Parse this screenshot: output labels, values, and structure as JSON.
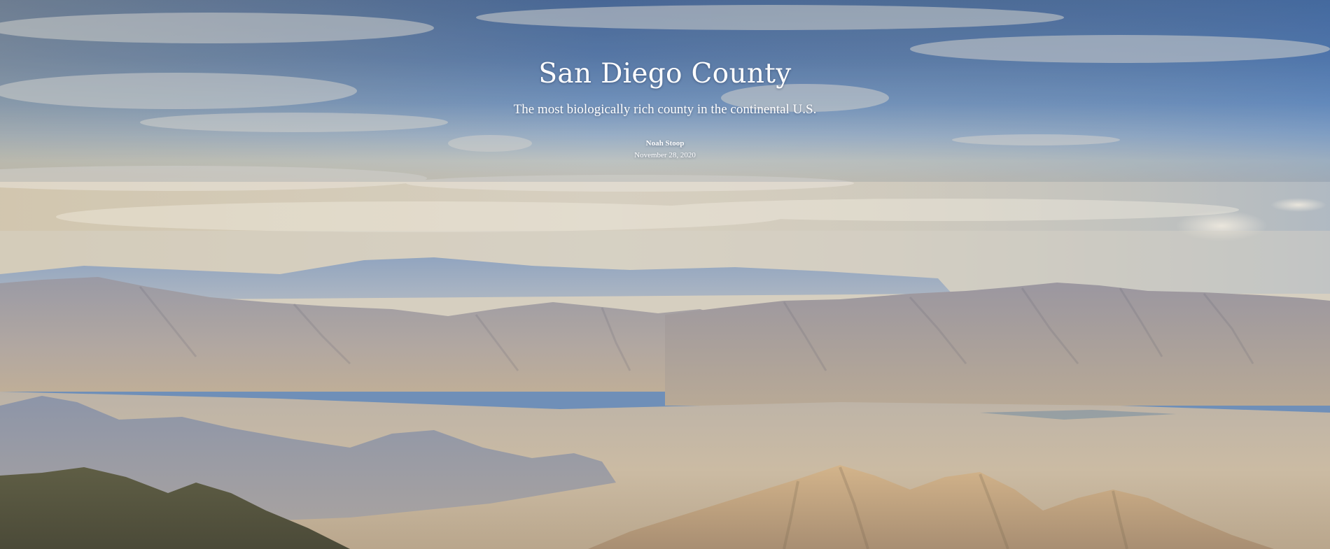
{
  "hero": {
    "title": "San Diego County",
    "subtitle": "The most biologically rich county in the continental U.S.",
    "author": "Noah Stoop",
    "date": "November 28, 2020"
  },
  "colors": {
    "sky_top": "#4f6f9e",
    "sky_mid": "#7d9cc4",
    "horizon_haze": "#d9d3c4",
    "far_mountains": "#8ea2bd",
    "mid_mountains": "#a6a2a6",
    "desert_floor": "#c9b9a3",
    "foreground_peaks": "#c9ab85",
    "dark_ridge": "#6d6a4c",
    "text": "#ffffff"
  }
}
